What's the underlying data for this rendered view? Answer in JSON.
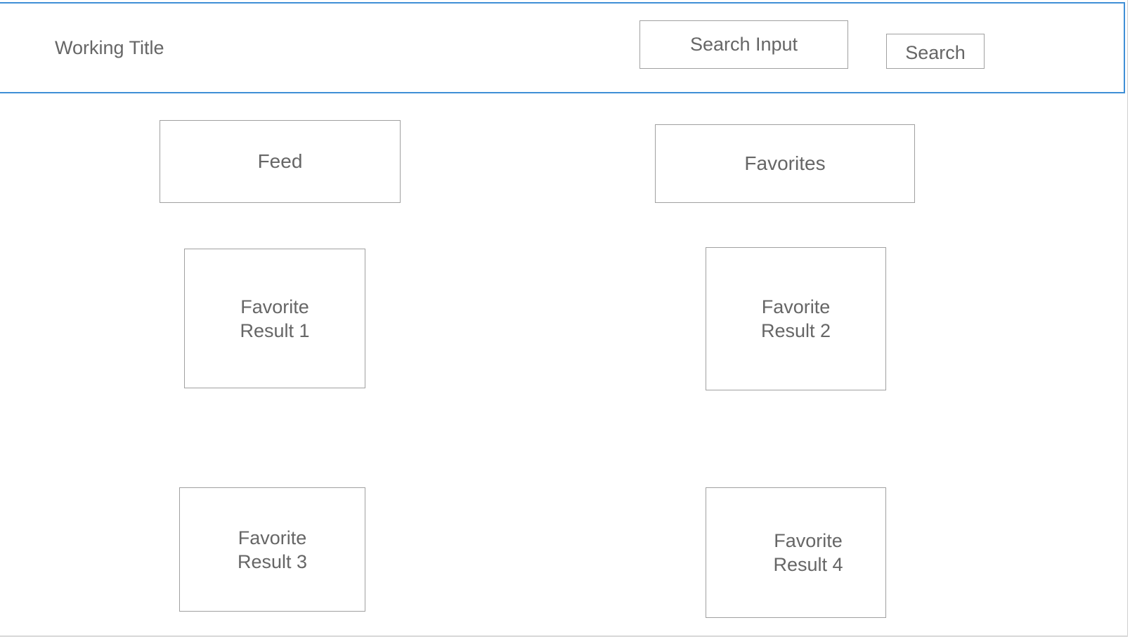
{
  "header": {
    "title": "Working Title",
    "search_placeholder": "Search Input",
    "search_button_label": "Search"
  },
  "nav": {
    "feed_label": "Feed",
    "favorites_label": "Favorites"
  },
  "favorites": [
    {
      "line1": "Favorite",
      "line2": "Result 1"
    },
    {
      "line1": "Favorite",
      "line2": "Result 2"
    },
    {
      "line1": "Favorite",
      "line2": "Result 3"
    },
    {
      "line1": "Favorite",
      "line2": "Result 4"
    }
  ],
  "colors": {
    "header_border": "#3f8fd6",
    "box_border": "#a0a0a0",
    "text": "#666666"
  }
}
